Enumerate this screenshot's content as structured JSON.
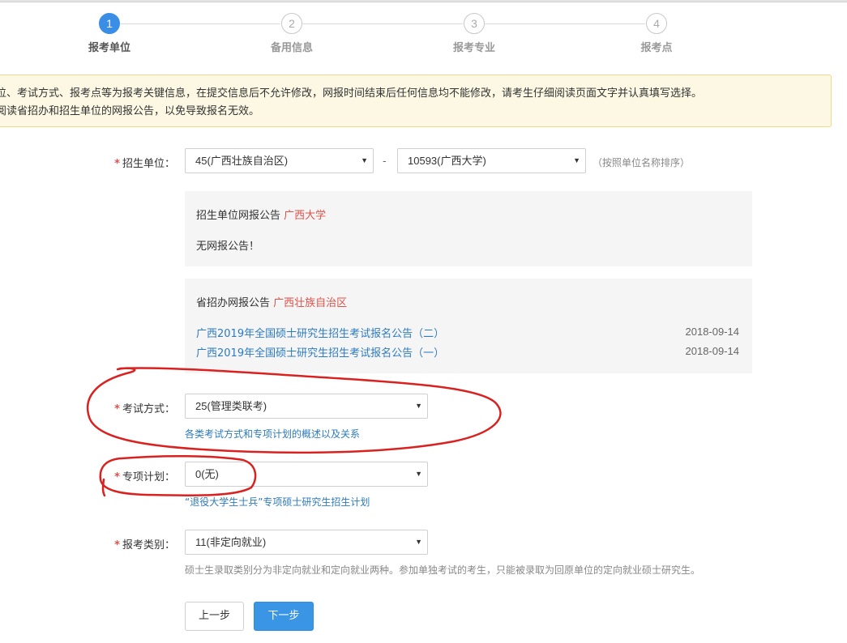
{
  "steps": [
    {
      "num": "1",
      "label": "报考单位"
    },
    {
      "num": "2",
      "label": "备用信息"
    },
    {
      "num": "3",
      "label": "报考专业"
    },
    {
      "num": "4",
      "label": "报考点"
    }
  ],
  "notice": {
    "line1": "位、考试方式、报考点等为报考关键信息，在提交信息后不允许修改，网报时间结束后任何信息均不能修改，请考生仔细阅读页面文字并认真填写选择。",
    "line2": "阅读省招办和招生单位的网报公告，以免导致报名无效。"
  },
  "form": {
    "required_mark": "*",
    "unit": {
      "label": "招生单位：",
      "province": "45(广西壮族自治区)",
      "separator": "-",
      "school": "10593(广西大学)",
      "hint": "（按照单位名称排序）"
    },
    "unit_notice": {
      "title": "招生单位网报公告",
      "title_highlight": "广西大学",
      "text": "无网报公告！"
    },
    "province_notice": {
      "title": "省招办网报公告",
      "title_highlight": "广西壮族自治区",
      "items": [
        {
          "title": "广西2019年全国硕士研究生招生考试报名公告（二）",
          "date": "2018-09-14"
        },
        {
          "title": "广西2019年全国硕士研究生招生考试报名公告（一）",
          "date": "2018-09-14"
        }
      ]
    },
    "exam_method": {
      "label": "考试方式：",
      "value": "25(管理类联考)",
      "link": "各类考试方式和专项计划的概述以及关系"
    },
    "special_plan": {
      "label": "专项计划：",
      "value": "0(无)",
      "link": "“退役大学生士兵”专项硕士研究生招生计划"
    },
    "category": {
      "label": "报考类别：",
      "value": "11(非定向就业)",
      "hint": "硕士生录取类别分为非定向就业和定向就业两种。参加单独考试的考生，只能被录取为回原单位的定向就业硕士研究生。"
    }
  },
  "buttons": {
    "prev": "上一步",
    "next": "下一步"
  },
  "colors": {
    "accent": "#3a8ee6",
    "required": "#d9534f",
    "link": "#2d7bbf",
    "annotation": "#d9221f"
  }
}
